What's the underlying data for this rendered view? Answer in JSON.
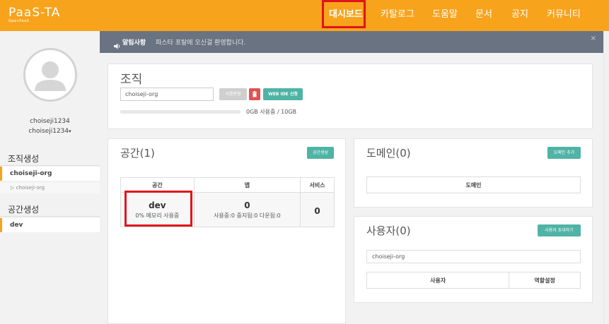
{
  "header": {
    "logo": "PaaS-TA",
    "logo_sub": "OpenPaaS",
    "nav": [
      {
        "label": "대시보드",
        "active": true
      },
      {
        "label": "카탈로그",
        "active": false
      },
      {
        "label": "도움말",
        "active": false
      },
      {
        "label": "문서",
        "active": false
      },
      {
        "label": "공지",
        "active": false
      },
      {
        "label": "커뮤니티",
        "active": false
      }
    ]
  },
  "sidebar": {
    "username": "choiseji1234",
    "username_dropdown": "choiseji1234",
    "dropdown_caret": "▾",
    "org_section_title": "조직생성",
    "org_item": "choiseji-org",
    "org_sub_item": "▷ choiseji-org",
    "space_section_title": "공간생성",
    "space_item": "dev"
  },
  "notice": {
    "label": "알림사항",
    "text": "파스타 포탈에 오신걸 환영합니다.",
    "close": "×"
  },
  "org_panel": {
    "title": "조직",
    "org_name_value": "choiseji-org",
    "rename_button": "이름변경",
    "delete_icon": "trash-icon",
    "webide_button": "WEB IDE 신청",
    "usage_fraction": 0.0,
    "usage_text": "0GB 사용중 / 10GB"
  },
  "space_panel": {
    "title": "공간(1)",
    "create_button": "공간생성",
    "columns": [
      "공간",
      "앱",
      "서비스"
    ],
    "row": {
      "space": "dev",
      "memory": "0% 메모리 사용중",
      "app_count": "0",
      "app_status": "사용중:0 중지됨:0 다운됨:0",
      "service_count": "0"
    }
  },
  "domain_panel": {
    "title": "도메인(0)",
    "add_button": "도메인 추가",
    "column": "도메인"
  },
  "user_panel": {
    "title": "사용자(0)",
    "invite_button": "사용자 초대하기",
    "org_field": "choiseji-org",
    "columns": [
      "사용자",
      "역할설정"
    ]
  },
  "colors": {
    "brand_orange": "#f8a31c",
    "accent_teal": "#4fb3a5",
    "highlight_red": "#e0141c",
    "notice_bg": "#6a7381",
    "delete_red": "#e05252"
  }
}
